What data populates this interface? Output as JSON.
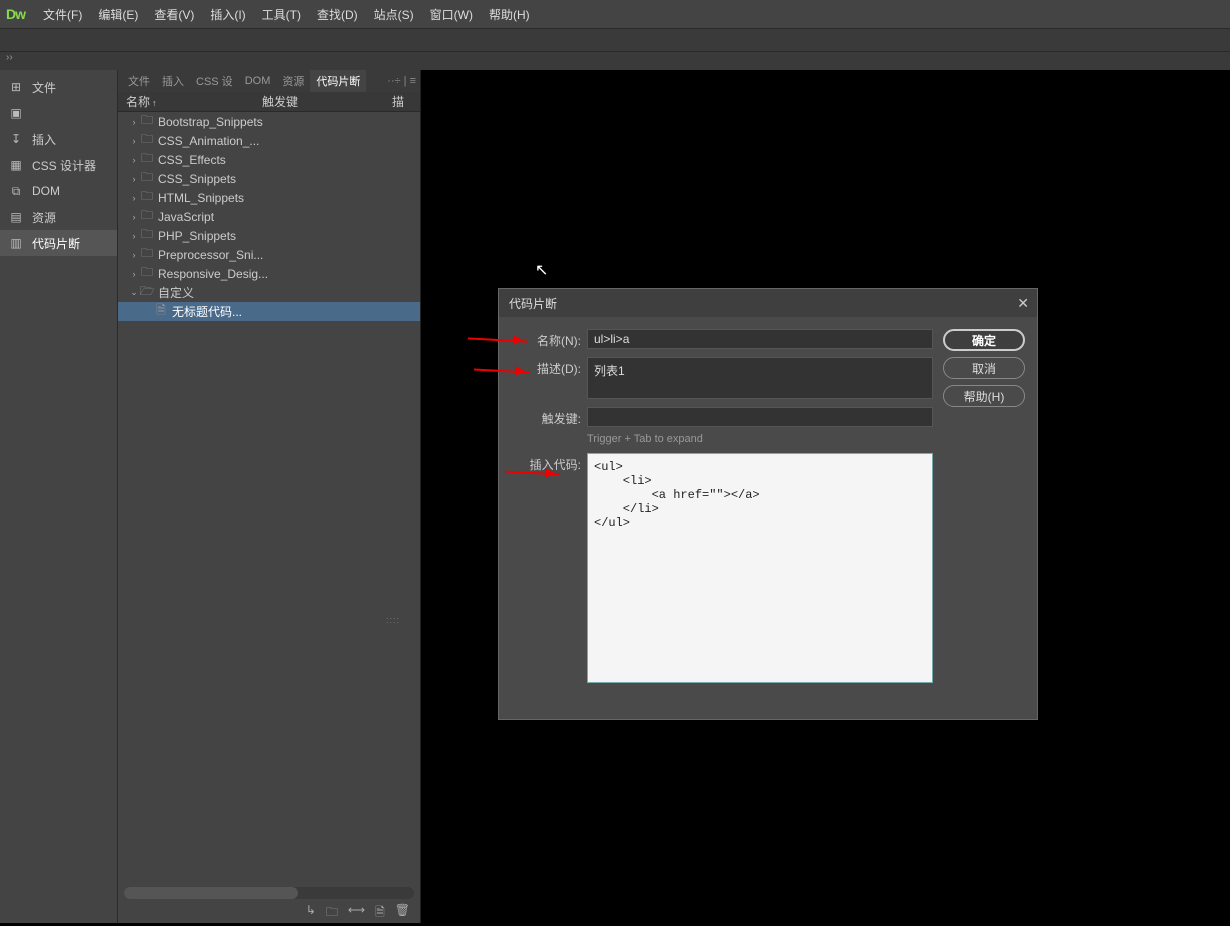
{
  "app": {
    "logo": "Dw"
  },
  "menu": [
    "文件(F)",
    "编辑(E)",
    "查看(V)",
    "插入(I)",
    "工具(T)",
    "查找(D)",
    "站点(S)",
    "窗口(W)",
    "帮助(H)"
  ],
  "expand_handle": "››",
  "rail": [
    {
      "icon": "⊞",
      "label": "文件"
    },
    {
      "icon": "▣",
      "label": ""
    },
    {
      "icon": "↧",
      "label": "插入"
    },
    {
      "icon": "▦",
      "label": "CSS 设计器"
    },
    {
      "icon": "⧉",
      "label": "DOM"
    },
    {
      "icon": "▤",
      "label": "资源"
    },
    {
      "icon": "▥",
      "label": "代码片断",
      "active": true
    }
  ],
  "panel_tabs": [
    "文件",
    "插入",
    "CSS 设",
    "DOM",
    "资源",
    "代码片断"
  ],
  "panel_active_tab": 5,
  "panel_tools": "··÷  | ≡",
  "headers": {
    "name": "名称",
    "sort": "↑",
    "trigger": "触发键",
    "desc": "描"
  },
  "tree": [
    {
      "depth": 1,
      "twist": ">",
      "folder": true,
      "label": "Bootstrap_Snippets"
    },
    {
      "depth": 1,
      "twist": ">",
      "folder": true,
      "label": "CSS_Animation_..."
    },
    {
      "depth": 1,
      "twist": ">",
      "folder": true,
      "label": "CSS_Effects"
    },
    {
      "depth": 1,
      "twist": ">",
      "folder": true,
      "label": "CSS_Snippets"
    },
    {
      "depth": 1,
      "twist": ">",
      "folder": true,
      "label": "HTML_Snippets"
    },
    {
      "depth": 1,
      "twist": ">",
      "folder": true,
      "label": "JavaScript"
    },
    {
      "depth": 1,
      "twist": ">",
      "folder": true,
      "label": "PHP_Snippets"
    },
    {
      "depth": 1,
      "twist": ">",
      "folder": true,
      "label": "Preprocessor_Sni..."
    },
    {
      "depth": 1,
      "twist": ">",
      "folder": true,
      "label": "Responsive_Desig..."
    },
    {
      "depth": 1,
      "twist": "v",
      "folder": true,
      "open": true,
      "label": "自定义"
    },
    {
      "depth": 2,
      "twist": "",
      "folder": false,
      "file": true,
      "label": "无标题代码...",
      "selected": true
    }
  ],
  "footer_icons": [
    "↳",
    "🗀",
    "⟷",
    "🗎",
    "🗑"
  ],
  "dialog": {
    "title": "代码片断",
    "labels": {
      "name": "名称(N):",
      "desc": "描述(D):",
      "trigger": "触发键:",
      "insert": "插入代码:"
    },
    "fields": {
      "name": "ul>li>a",
      "desc": "列表1",
      "trigger": "",
      "hint": "Trigger + Tab to expand",
      "code": "<ul>\n    <li>\n        <a href=\"\"></a>\n    </li>\n</ul>"
    },
    "buttons": {
      "ok": "确定",
      "cancel": "取消",
      "help": "帮助(H)"
    }
  }
}
